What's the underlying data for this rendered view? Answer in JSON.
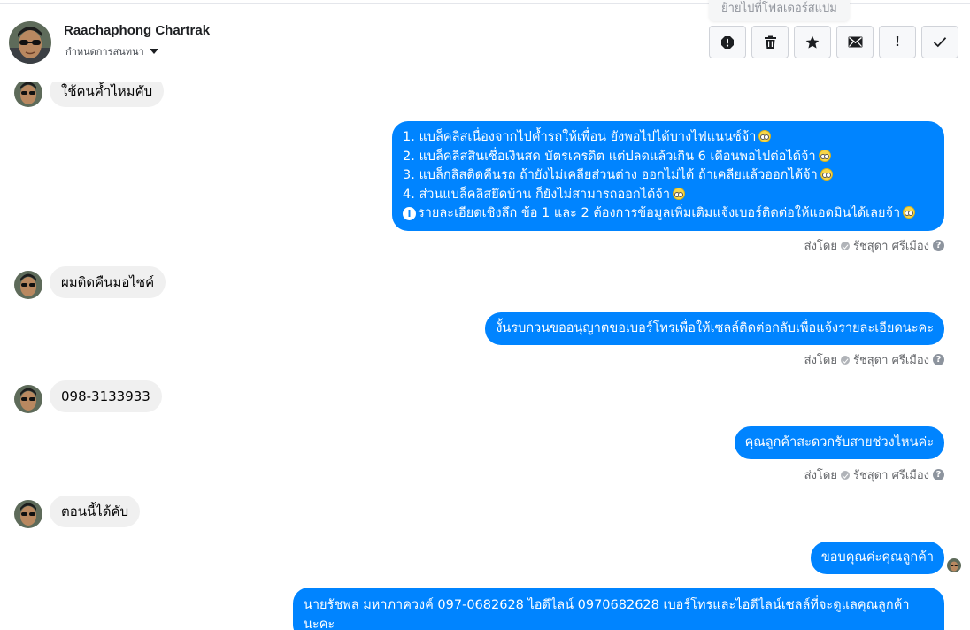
{
  "header": {
    "contact_name": "Raachaphong Chartrak",
    "assign_label": "กำหนดการสนทนา",
    "tooltip": "ย้ายไปที่โฟลเดอร์สแปม",
    "actions": [
      {
        "icon": "alert-circle-icon"
      },
      {
        "icon": "trash-icon"
      },
      {
        "icon": "star-icon"
      },
      {
        "icon": "mail-icon"
      },
      {
        "icon": "exclamation-icon",
        "label": "!"
      },
      {
        "icon": "check-icon"
      }
    ]
  },
  "messages": {
    "in_1": "ใช้คนค้ำไหมคับ",
    "out_1_lines": [
      "1. แบล็คลิสเนื่องจากไปค้ำรถให้เพื่อน ยังพอไปได้บางไฟแนนซ์จ้า",
      "2. แบล็คลิสสินเชื่อเงินสด บัตรเครดิต แต่ปลดแล้วเกิน 6 เดือนพอไปต่อได้จ้า",
      "3. แบล็กลิสติดคืนรถ ถ้ายังไม่เคลียส่วนต่าง ออกไม่ได้ ถ้าเคลียแล้วออกได้จ้า",
      "4. ส่วนแบล็คลิสยึดบ้าน ก็ยังไม่สามารถออกได้จ้า",
      "รายละเอียดเชิงลึก ข้อ 1 และ 2 ต้องการข้อมูลเพิ่มเติมแจ้งเบอร์ติดต่อให้แอดมินได้เลยจ้า"
    ],
    "in_2": "ผมติดคืนมอไซค์",
    "out_2": "งั้นรบกวนขออนุญาตขอเบอร์โทรเพื่อให้เซลล์ติดต่อกลับเพื่อแจ้งรายละเอียดนะคะ",
    "in_3": "098-3133933",
    "out_3": "คุณลูกค้าสะดวกรับสายช่วงไหนค่ะ",
    "in_4": "ตอนนี้ได้คับ",
    "out_4": "ขอบคุณค่ะคุณลูกค้า",
    "out_5_line1": "นายรัชพล มหาภาควงค์  097-0682628 ไอดีไลน์ 0970682628   เบอร์โทรและไอดีไลน์เซลล์ที่จะดูแลคุณลูกค้า",
    "out_5_line2": "นะคะ"
  },
  "sent_meta": {
    "prefix": "ส่งโดย",
    "sender": "รัชสุดา ศรีเมือง",
    "help": "?"
  },
  "colors": {
    "outgoing_bubble": "#0084ff",
    "incoming_bubble": "#f0f0f0"
  }
}
